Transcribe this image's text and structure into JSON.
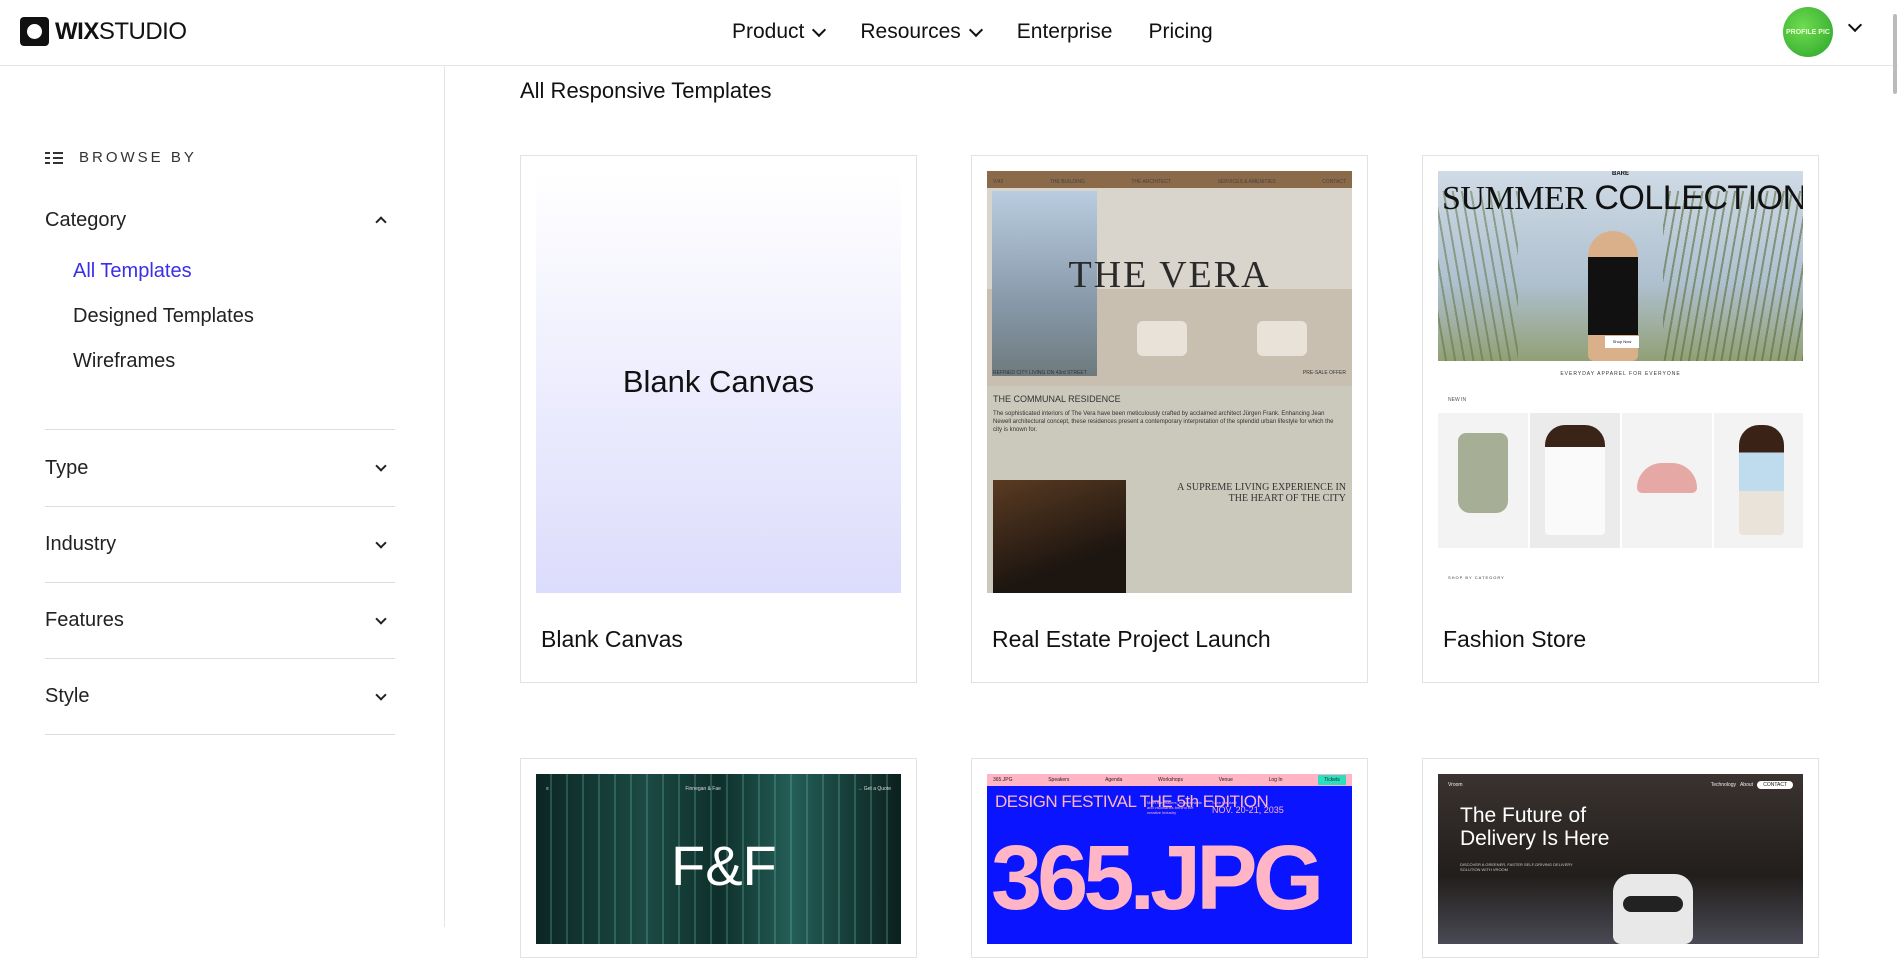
{
  "header": {
    "logo_bold": "WIX",
    "logo_light": "STUDIO",
    "nav": [
      {
        "label": "Product",
        "has_dropdown": true
      },
      {
        "label": "Resources",
        "has_dropdown": true
      },
      {
        "label": "Enterprise",
        "has_dropdown": false
      },
      {
        "label": "Pricing",
        "has_dropdown": false
      }
    ],
    "avatar_text": "PROFILE PIC"
  },
  "sidebar": {
    "browse_label": "BROWSE BY",
    "category": {
      "label": "Category",
      "expanded": true,
      "items": [
        {
          "label": "All Templates",
          "active": true
        },
        {
          "label": "Designed Templates",
          "active": false
        },
        {
          "label": "Wireframes",
          "active": false
        }
      ]
    },
    "filters": [
      {
        "label": "Type"
      },
      {
        "label": "Industry"
      },
      {
        "label": "Features"
      },
      {
        "label": "Style"
      }
    ]
  },
  "main": {
    "title": "All Responsive Templates",
    "cards": [
      {
        "label": "Blank Canvas",
        "preview_text": "Blank Canvas"
      },
      {
        "label": "Real Estate Project Launch"
      },
      {
        "label": "Fashion Store"
      }
    ]
  },
  "previews": {
    "vera": {
      "logo": "V/42",
      "nav": [
        "THE BUILDING",
        "THE ARCHITECT",
        "SERVICES & AMENITIES",
        "CONTACT"
      ],
      "title": "THE VERA",
      "strip_left": "REFINED CITY LIVING ON 43rd STREET",
      "strip_right": "PRE-SALE OFFER",
      "subtitle": "THE COMMUNAL RESIDENCE",
      "body": "The sophisticated interiors of The Vera have been meticulously crafted by acclaimed architect Jürgen Frank. Enhancing Jean Newell architectural concept, these residences present a contemporary interpretation of the splendid urban lifestyle for which the city is known for.",
      "tagline": "A SUPREME LIVING EXPERIENCE IN THE HEART OF THE CITY"
    },
    "fashion": {
      "brand": "BARE",
      "title_serif": "SUMMER",
      "title_sans": "COLLECTION",
      "button": "Shop Now",
      "caption": "EVERYDAY APPAREL FOR EVERYONE",
      "new_in": "NEW IN",
      "shop": "SHOP BY CATEGORY"
    },
    "ff": {
      "big": "F&F",
      "nav_center": "Finnegan & Fae",
      "nav_right": "→ Get a Quote"
    },
    "design": {
      "nav_left": "365.JPG",
      "nav_items": [
        "Speakers",
        "Agenda",
        "Workshops",
        "Venue"
      ],
      "login": "Log In",
      "tickets": "Tickets",
      "title": "DESIGN FESTIVAL THE 5th EDITION",
      "mid": "Meet the makers, masterminds and visionaries behind the creative industry",
      "date_label": "Save the date",
      "date": "NOV. 20-21, 2035",
      "big": "365.JPG"
    },
    "delivery": {
      "brand": "Vroom",
      "nav_items": [
        "Technology",
        "About"
      ],
      "contact": "CONTACT",
      "title": "The Future of Delivery Is Here",
      "sub": "DISCOVER A GREENER, FASTER SELF-DRIVING DELIVERY SOLUTION WITH VROOM"
    }
  }
}
